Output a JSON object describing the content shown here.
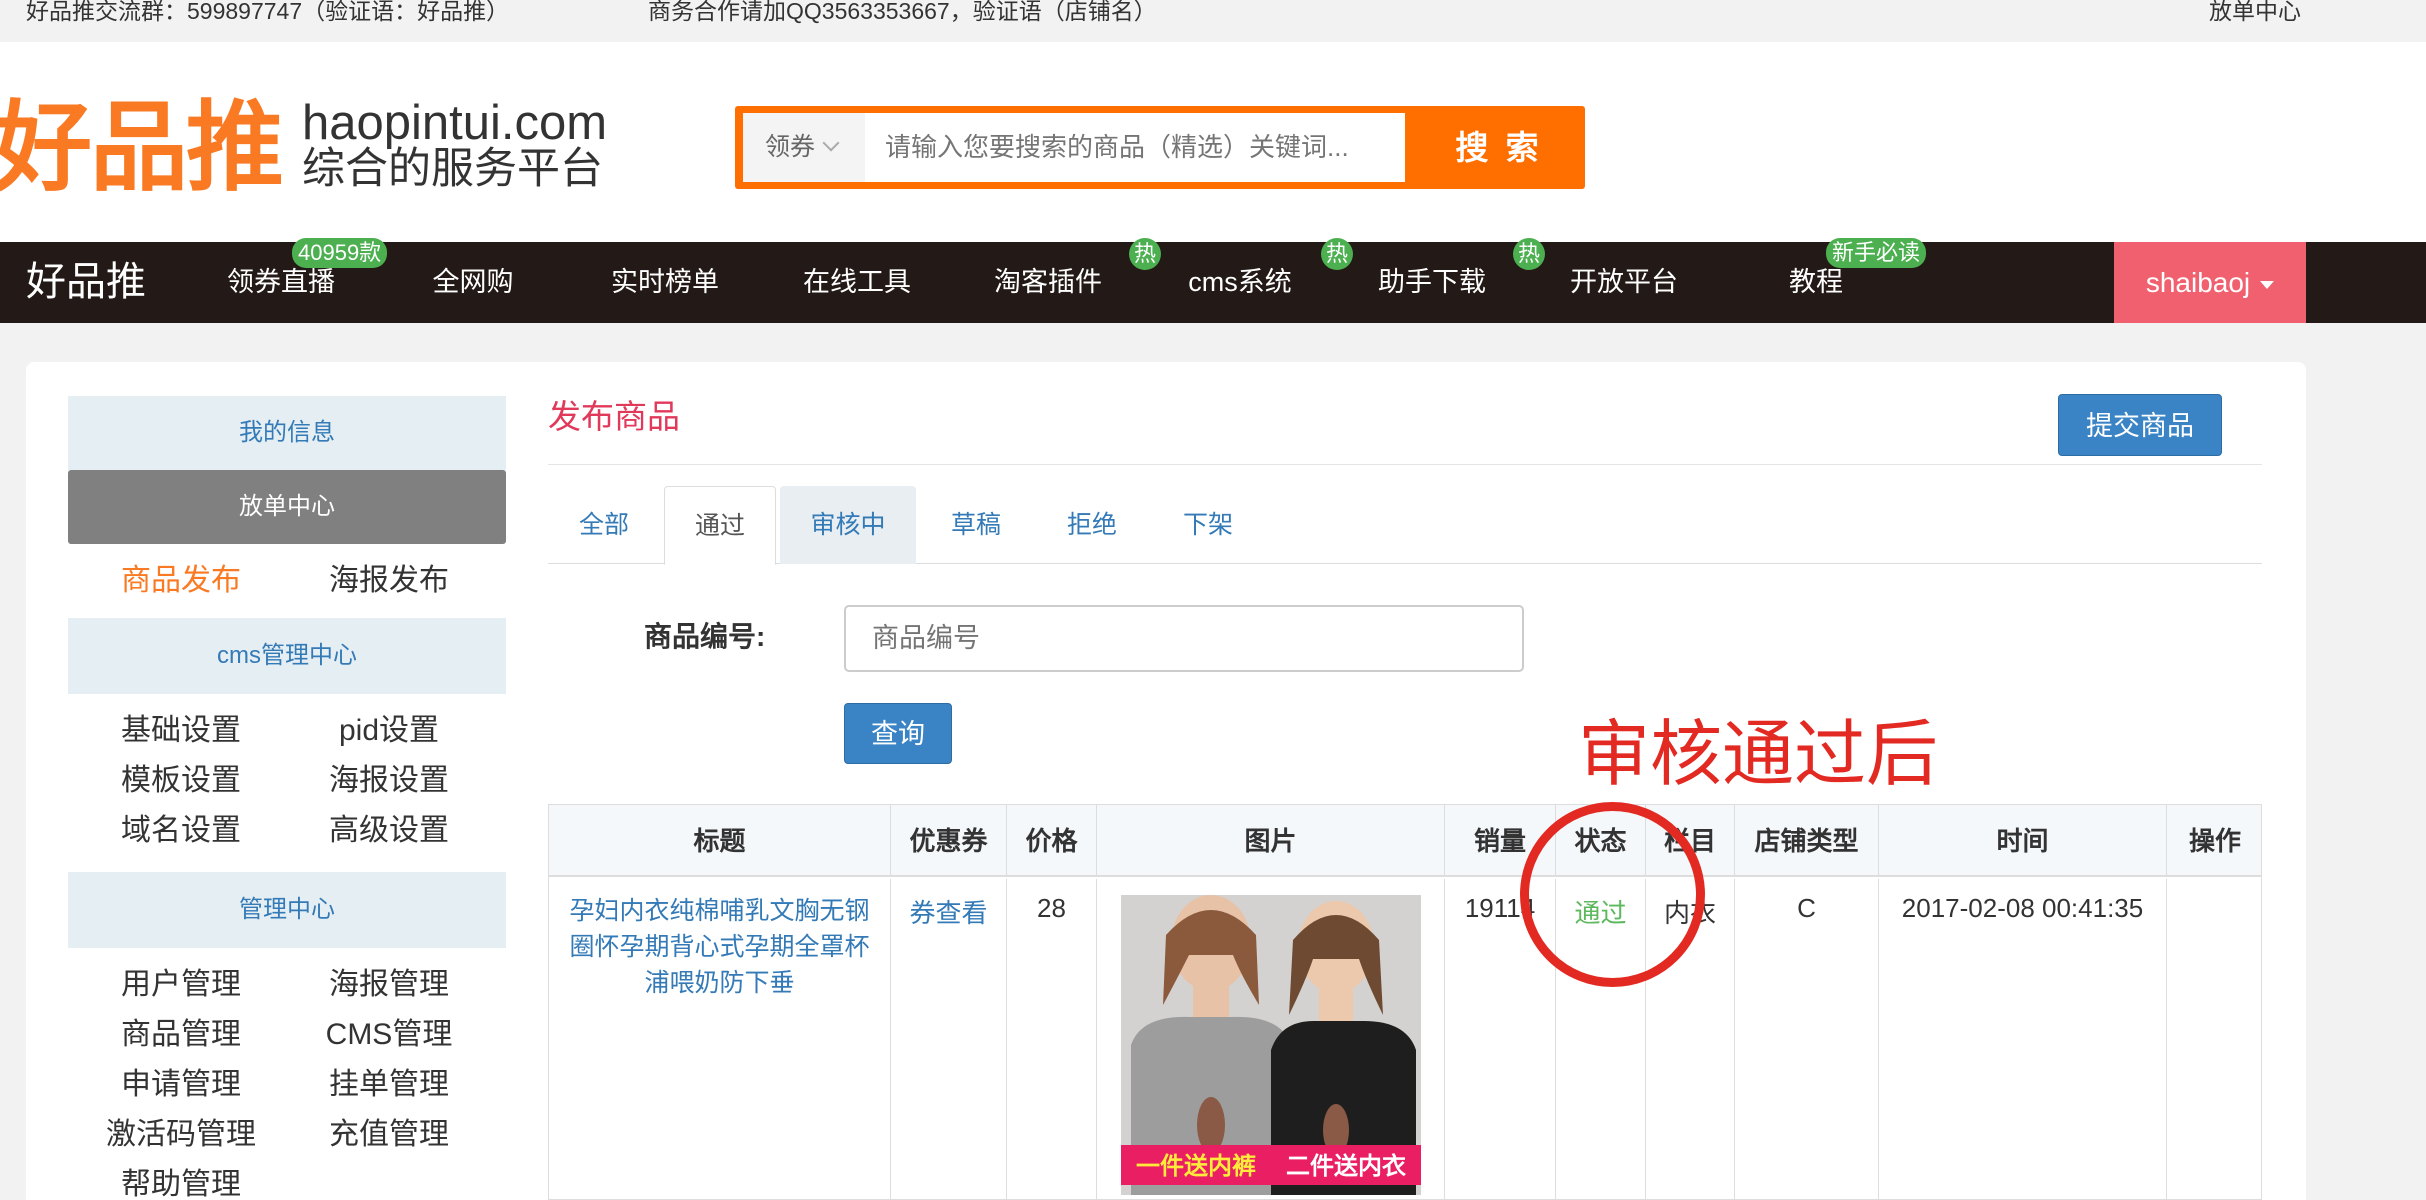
{
  "topbar": {
    "group": "好品推交流群：599897747（验证语：好品推）",
    "business": "商务合作请加QQ3563353667，验证语（店铺名）",
    "center": "放单中心"
  },
  "header": {
    "logo_cn": "好品推",
    "logo_en": "haopintui.com",
    "logo_sub": "综合的服务平台",
    "search_select": "领券",
    "search_placeholder": "请输入您要搜索的商品（精选）关键词...",
    "search_button": "搜 索"
  },
  "nav": {
    "brand": "好品推",
    "items": [
      {
        "label": "领券直播",
        "badge": "40959款"
      },
      {
        "label": "全网购",
        "badge": ""
      },
      {
        "label": "实时榜单",
        "badge": ""
      },
      {
        "label": "在线工具",
        "badge": ""
      },
      {
        "label": "淘客插件",
        "badge": "热"
      },
      {
        "label": "cms系统",
        "badge": "热"
      },
      {
        "label": "助手下载",
        "badge": "热"
      },
      {
        "label": "开放平台",
        "badge": ""
      },
      {
        "label": "教程",
        "badge": "新手必读"
      }
    ],
    "user": "shaibaoj"
  },
  "sidebar": {
    "my_info": "我的信息",
    "order_center": "放单中心",
    "publish_goods": "商品发布",
    "publish_poster": "海报发布",
    "cms_center": "cms管理中心",
    "cms_items": [
      [
        "基础设置",
        "pid设置"
      ],
      [
        "模板设置",
        "海报设置"
      ],
      [
        "域名设置",
        "高级设置"
      ]
    ],
    "manage_center": "管理中心",
    "manage_items": [
      [
        "用户管理",
        "海报管理"
      ],
      [
        "商品管理",
        "CMS管理"
      ],
      [
        "申请管理",
        "挂单管理"
      ],
      [
        "激活码管理",
        "充值管理"
      ],
      [
        "帮助管理",
        ""
      ]
    ]
  },
  "main": {
    "title": "发布商品",
    "submit_button": "提交商品",
    "tabs": [
      "全部",
      "通过",
      "审核中",
      "草稿",
      "拒绝",
      "下架"
    ],
    "active_tab": "通过",
    "filter_label": "商品编号:",
    "filter_placeholder": "商品编号",
    "query_button": "查询",
    "annotation": "审核通过后"
  },
  "table": {
    "headers": [
      "标题",
      "优惠券",
      "价格",
      "图片",
      "销量",
      "状态",
      "栏目",
      "店铺类型",
      "时间",
      "操作"
    ],
    "row": {
      "title": "孕妇内衣纯棉哺乳文胸无钢圈怀孕期背心式孕期全罩杯浦喂奶防下垂",
      "coupon": "券查看",
      "price": "28",
      "image_banner_left": "一件送内裤",
      "image_banner_right": "二件送内衣",
      "sales": "19114",
      "status": "通过",
      "category": "内衣",
      "shop_type": "C",
      "time": "2017-02-08 00:41:35",
      "action": ""
    }
  },
  "colors": {
    "brand_orange": "#f97a23",
    "search_orange": "#ff6f00",
    "nav_dark": "#231916",
    "user_pink": "#f0606e",
    "link_blue": "#337ab7",
    "badge_green": "#4caf50",
    "annotation_red": "#e32a22"
  },
  "icons": [
    "chevron-down-icon",
    "caret-down-icon"
  ]
}
